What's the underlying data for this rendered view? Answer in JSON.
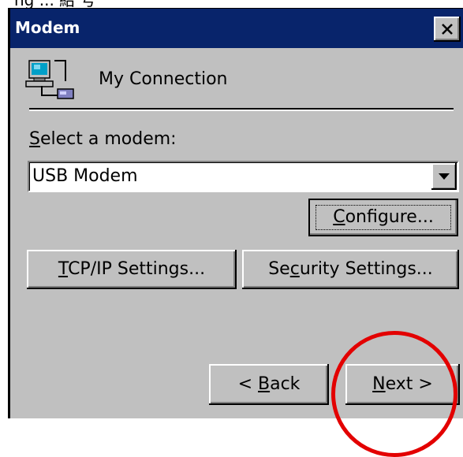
{
  "top_fragment": "ng  ...   紹 号",
  "window": {
    "title": "Modem",
    "close_glyph": "×"
  },
  "connection": {
    "name": "My Connection",
    "icon": "network-connection-icon"
  },
  "modem_select": {
    "label_accel": "S",
    "label_rest": "elect a modem:",
    "value": "USB Modem"
  },
  "buttons": {
    "configure_accel": "C",
    "configure_rest": "onfigure...",
    "tcpip_accel": "T",
    "tcpip_rest": "CP/IP Settings...",
    "security_pre": "Se",
    "security_accel": "c",
    "security_rest": "urity Settings...",
    "back_pre": "< ",
    "back_accel": "B",
    "back_rest": "ack",
    "next_accel": "N",
    "next_rest": "ext >"
  },
  "colors": {
    "titlebar": "#08246b",
    "dialog_face": "#c0c0c0",
    "annotation_circle": "#e30000"
  }
}
